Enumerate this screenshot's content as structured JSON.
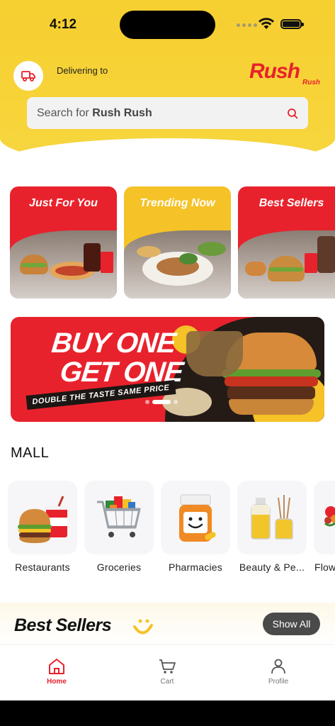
{
  "status_bar": {
    "time": "4:12"
  },
  "header": {
    "delivering_label": "Delivering to",
    "logo_text": "Rush",
    "logo_subtext": "Rush",
    "search_placeholder_prefix": "Search for ",
    "search_placeholder_brand": "Rush Rush"
  },
  "category_cards": [
    {
      "title": "Just For You",
      "color": "#e8222c"
    },
    {
      "title": "Trending Now",
      "color": "#f5c227"
    },
    {
      "title": "Best Sellers",
      "color": "#e8222c"
    }
  ],
  "promo_banner": {
    "line1": "BUY ONE",
    "line2": "GET ONE",
    "tagline": "DOUBLE THE TASTE SAME PRICE",
    "active_slide": 2,
    "slide_count": 3
  },
  "mall": {
    "title": "MALL",
    "items": [
      {
        "label": "Restaurants",
        "icon": "burger-icon"
      },
      {
        "label": "Groceries",
        "icon": "shopping-cart-icon"
      },
      {
        "label": "Pharmacies",
        "icon": "pill-bottle-icon"
      },
      {
        "label": "Beauty & Pe...",
        "icon": "perfume-icon"
      },
      {
        "label": "Flow",
        "icon": "flower-icon"
      }
    ]
  },
  "best_sellers": {
    "title": "Best Sellers",
    "show_all_label": "Show All"
  },
  "tab_bar": {
    "tabs": [
      {
        "label": "Home",
        "icon": "home-icon",
        "active": true
      },
      {
        "label": "Cart",
        "icon": "cart-icon",
        "active": false
      },
      {
        "label": "Profile",
        "icon": "profile-icon",
        "active": false
      }
    ]
  },
  "colors": {
    "brand_red": "#e8212b",
    "brand_yellow": "#f6cf30"
  }
}
